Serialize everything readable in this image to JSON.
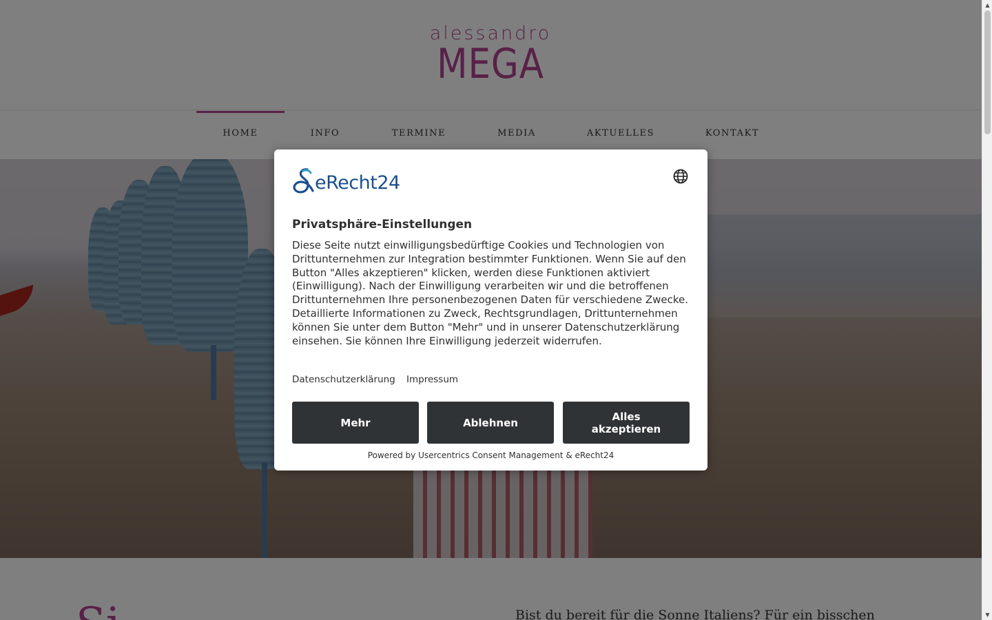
{
  "site": {
    "logo_top": "alessandro",
    "logo_main": "MEGA",
    "accent_color": "#b0428f"
  },
  "nav": {
    "items": [
      {
        "label": "HOME",
        "active": true
      },
      {
        "label": "INFO",
        "active": false
      },
      {
        "label": "TERMINE",
        "active": false
      },
      {
        "label": "MEDIA",
        "active": false
      },
      {
        "label": "AKTUELLES",
        "active": false
      },
      {
        "label": "KONTAKT",
        "active": false
      }
    ]
  },
  "content": {
    "heading_partial": "Si",
    "intro_text": "Bist du bereit für die Sonne Italiens? Für ein bisschen"
  },
  "consent": {
    "brand": "eRecht24",
    "title": "Privatsphäre-Einstellungen",
    "body": "Diese Seite nutzt einwilligungsbedürftige Cookies und Technologien von Drittunternehmen zur Integration bestimmter Funktionen. Wenn Sie auf den Button \"Alles akzeptieren\" klicken, werden diese Funktionen aktiviert (Einwilligung). Nach der Einwilligung verarbeiten wir und die betroffenen Drittunternehmen Ihre personenbezogenen Daten für verschiedene Zwecke. Detaillierte Informationen zu Zweck, Rechtsgrundlagen, Drittunternehmen können Sie unter dem Button \"Mehr\" und in unserer Datenschutzerklärung einsehen. Sie können Ihre Einwilligung jederzeit widerrufen.",
    "links": [
      "Datenschutzerklärung",
      "Impressum"
    ],
    "buttons": {
      "more": "Mehr",
      "decline": "Ablehnen",
      "accept_all": "Alles akzeptieren"
    },
    "button_color": "#303336",
    "powered_by": "Powered by Usercentrics Consent Management & eRecht24",
    "icons": {
      "language": "globe-icon"
    }
  }
}
